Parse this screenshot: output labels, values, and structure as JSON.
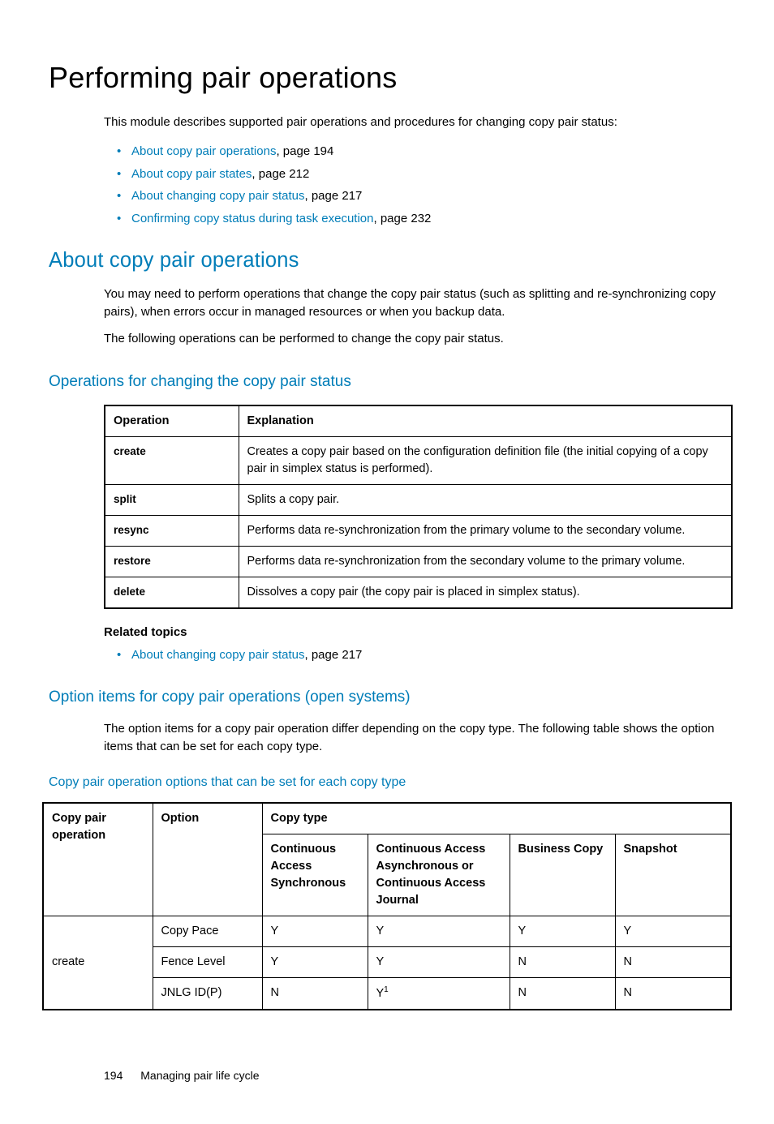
{
  "title": "Performing pair operations",
  "intro": "This module describes supported pair operations and procedures for changing copy pair status:",
  "toc": [
    {
      "link": "About copy pair operations",
      "suffix": ", page 194"
    },
    {
      "link": "About copy pair states",
      "suffix": ", page 212"
    },
    {
      "link": "About changing copy pair status",
      "suffix": ", page 217"
    },
    {
      "link": "Confirming copy status during task execution",
      "suffix": ", page 232"
    }
  ],
  "section1": {
    "heading": "About copy pair operations",
    "p1": "You may need to perform operations that change the copy pair status (such as splitting and re-synchronizing copy pairs), when errors occur in managed resources or when you backup data.",
    "p2": "The following operations can be performed to change the copy pair status."
  },
  "section2": {
    "heading": "Operations for changing the copy pair status",
    "table": {
      "headers": {
        "c1": "Operation",
        "c2": "Explanation"
      },
      "rows": [
        {
          "op": "create",
          "exp": "Creates a copy pair based on the configuration definition file (the initial copying of a copy pair in simplex status is performed)."
        },
        {
          "op": "split",
          "exp": "Splits a copy pair."
        },
        {
          "op": "resync",
          "exp": "Performs data re-synchronization from the primary volume to the secondary volume."
        },
        {
          "op": "restore",
          "exp": "Performs data re-synchronization from the secondary volume to the primary volume."
        },
        {
          "op": "delete",
          "exp": "Dissolves a copy pair (the copy pair is placed in simplex status)."
        }
      ]
    },
    "related_heading": "Related topics",
    "related": {
      "link": "About changing copy pair status",
      "suffix": ", page 217"
    }
  },
  "section3": {
    "heading": "Option items for copy pair operations (open systems)",
    "p1": "The option items for a copy pair operation differ depending on the copy type. The following table shows the option items that can be set for each copy type.",
    "caption": "Copy pair operation options that can be set for each copy type",
    "table": {
      "header_row1": {
        "c1": "Copy pair operation",
        "c2": "Option",
        "c3": "Copy type"
      },
      "header_row2": {
        "c3a": "Continuous Access Synchronous",
        "c3b": "Continuous Access Asynchronous or Continuous Access Journal",
        "c3c": "Business Copy",
        "c3d": "Snapshot"
      },
      "body": {
        "op": "create",
        "rows": [
          {
            "opt": "Copy Pace",
            "v1": "Y",
            "v2": "Y",
            "v3": "Y",
            "v4": "Y"
          },
          {
            "opt": "Fence Level",
            "v1": "Y",
            "v2": "Y",
            "v3": "N",
            "v4": "N"
          },
          {
            "opt": "JNLG ID(P)",
            "v1": "N",
            "v2": "Y",
            "v2_sup": "1",
            "v3": "N",
            "v4": "N"
          }
        ]
      }
    }
  },
  "footer": {
    "page": "194",
    "chapter": "Managing pair life cycle"
  }
}
